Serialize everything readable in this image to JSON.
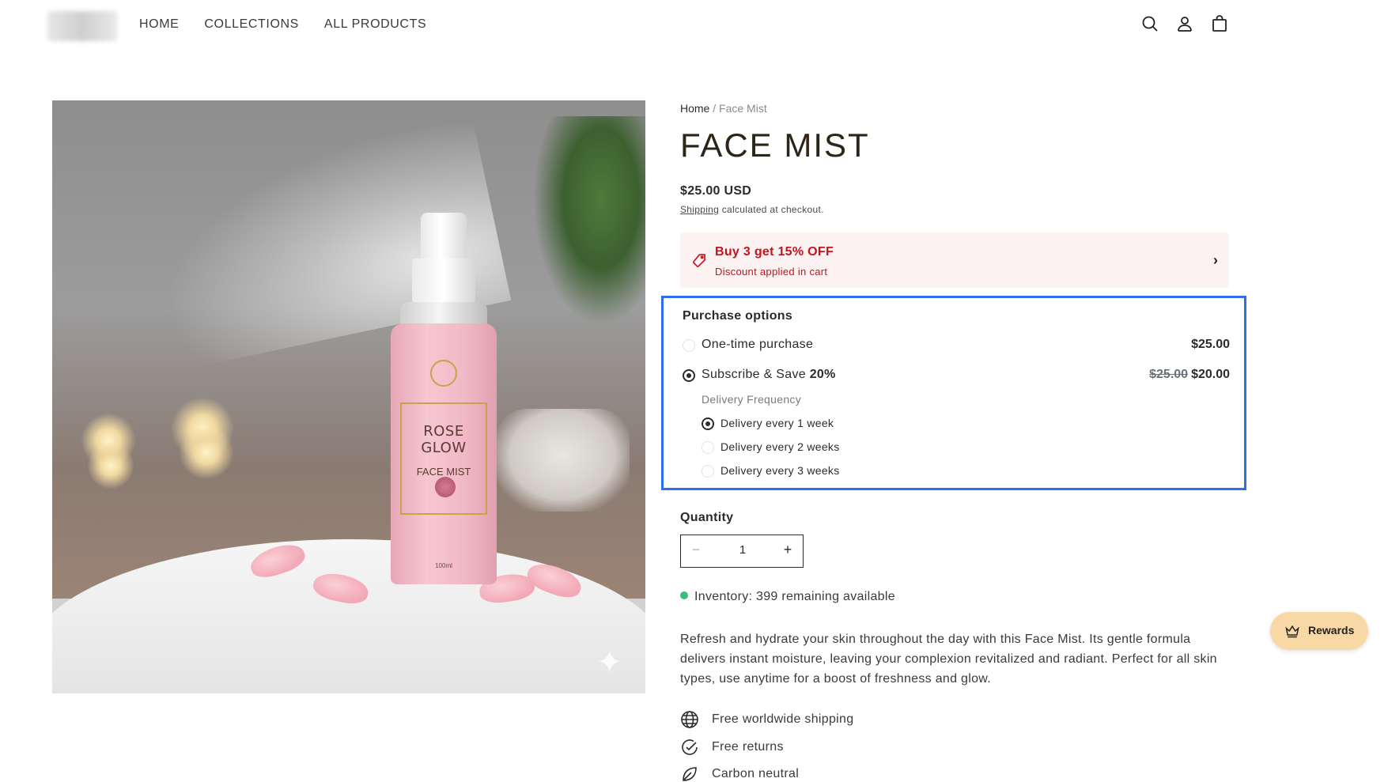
{
  "header": {
    "nav": [
      "HOME",
      "COLLECTIONS",
      "ALL PRODUCTS"
    ],
    "icons": [
      "search-icon",
      "account-icon",
      "cart-icon"
    ]
  },
  "image": {
    "label_line1": "ROSE GLOW",
    "label_line2": "FACE MIST",
    "volume": "100ml"
  },
  "breadcrumb": {
    "home": "Home",
    "separator": "/",
    "current": "Face Mist"
  },
  "product": {
    "title": "FACE MIST",
    "price": "$25.00 USD",
    "shipping_link": "Shipping",
    "shipping_text": " calculated at checkout."
  },
  "discount": {
    "title": "Buy 3 get 15% OFF",
    "subtitle": "Discount applied in cart",
    "accent_color": "#c0141f"
  },
  "purchase_options": {
    "title": "Purchase options",
    "one_time": {
      "label": "One-time purchase",
      "price": "$25.00",
      "selected": false
    },
    "subscribe": {
      "label": "Subscribe & Save ",
      "percent": "20%",
      "old_price": "$25.00",
      "price": "$20.00",
      "selected": true
    },
    "frequency_label": "Delivery Frequency",
    "frequencies": [
      {
        "label": "Delivery every 1 week",
        "selected": true
      },
      {
        "label": "Delivery every 2 weeks",
        "selected": false
      },
      {
        "label": "Delivery every 3 weeks",
        "selected": false
      }
    ],
    "highlight_color": "#2f6ded"
  },
  "quantity": {
    "label": "Quantity",
    "value": "1",
    "minus": "−",
    "plus": "+"
  },
  "inventory": {
    "text": "Inventory: 399 remaining available",
    "status_color": "#3bbd7a"
  },
  "description": "Refresh and hydrate your skin throughout the day with this Face Mist. Its gentle formula delivers instant moisture, leaving your complexion revitalized and radiant. Perfect for all skin types, use anytime for a boost of freshness and glow.",
  "features": [
    {
      "icon": "globe-icon",
      "text": "Free worldwide shipping"
    },
    {
      "icon": "check-circle-icon",
      "text": "Free returns"
    },
    {
      "icon": "leaf-icon",
      "text": "Carbon neutral"
    }
  ],
  "rewards": {
    "label": "Rewards",
    "icon": "crown-icon"
  }
}
